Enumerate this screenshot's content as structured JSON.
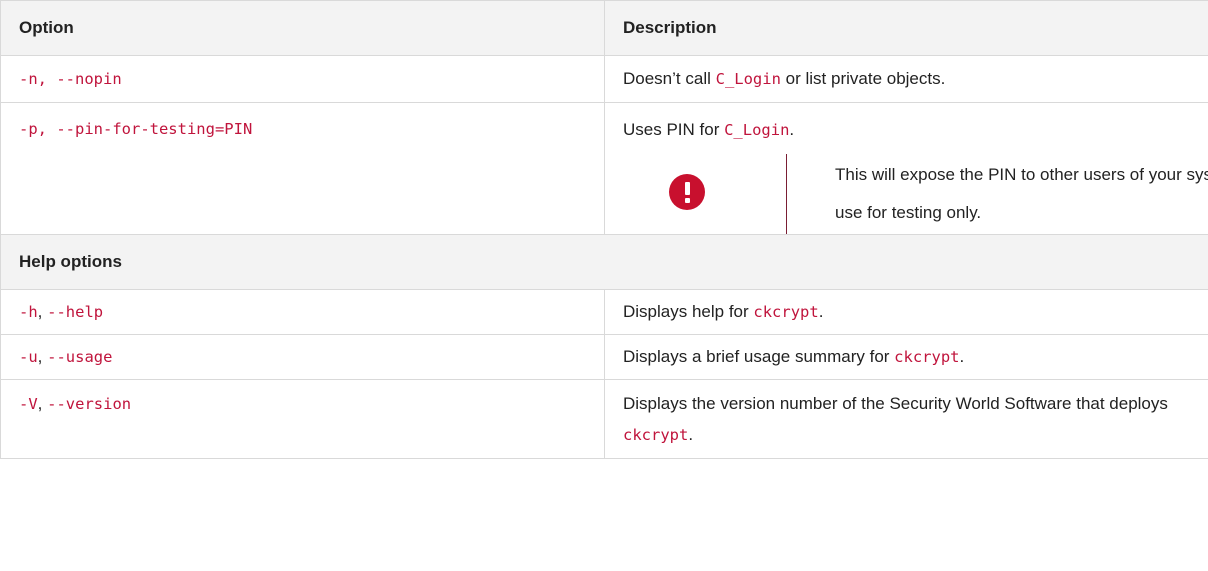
{
  "table": {
    "headers": {
      "option": "Option",
      "description": "Description"
    },
    "rows": [
      {
        "option": "-n, --nopin",
        "desc_before": "Doesn’t call ",
        "desc_code": "C_Login",
        "desc_after": " or list private objects."
      },
      {
        "option": "-p, --pin-for-testing=PIN",
        "desc_before": "Uses PIN for ",
        "desc_code": "C_Login",
        "desc_after": ".",
        "warning": {
          "icon": "exclamation-circle-icon",
          "color": "#c8102e",
          "text": "This will expose the PIN to other users of your system, use for testing only."
        }
      }
    ],
    "section": "Help options",
    "help_rows": [
      {
        "opt_a": "-h",
        "sep": ", ",
        "opt_b": "--help",
        "desc_before": "Displays help for ",
        "desc_code": "ckcrypt",
        "desc_after": "."
      },
      {
        "opt_a": "-u",
        "sep": ", ",
        "opt_b": "--usage",
        "desc_before": "Displays a brief usage summary for ",
        "desc_code": "ckcrypt",
        "desc_after": "."
      },
      {
        "opt_a": "-V",
        "sep": ", ",
        "opt_b": "--version",
        "desc_before": "Displays the version number of the Security World Software that deploys ",
        "desc_code": "ckcrypt",
        "desc_after": "."
      }
    ]
  },
  "colors": {
    "code": "#c0143c",
    "header_bg": "#f3f3f3",
    "border": "#d9d9d9"
  }
}
